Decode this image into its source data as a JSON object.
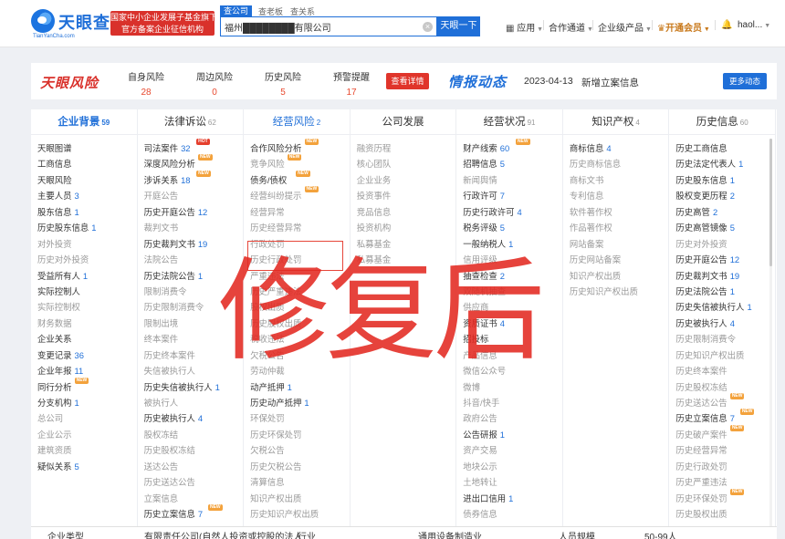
{
  "header": {
    "logo_title": "天眼查",
    "logo_sub": "TianYanCha.com",
    "gov_badge_line1": "国家中小企业发展子基金旗下",
    "gov_badge_line2": "官方备案企业征信机构",
    "search_tabs": [
      "查公司",
      "查老板",
      "查关系"
    ],
    "search_value": "福州████████有限公司",
    "search_button": "天眼一下",
    "nav": {
      "apps": "应用",
      "channel": "合作通道",
      "enterprise": "企业级产品",
      "vip": "开通会员",
      "user": "haol..."
    }
  },
  "risk": {
    "logo": "天眼风险",
    "stats": [
      {
        "label": "自身风险",
        "value": "28"
      },
      {
        "label": "周边风险",
        "value": "0"
      },
      {
        "label": "历史风险",
        "value": "5"
      },
      {
        "label": "预警提醒",
        "value": "17"
      }
    ],
    "detail_button": "查看详情",
    "intel_logo": "情报动态",
    "intel_date": "2023-04-13",
    "intel_text": "新增立案信息",
    "more_button": "更多动态"
  },
  "stamp_text": "修复后",
  "columns": [
    {
      "title": "企业背景",
      "count": "59",
      "items": [
        {
          "t": "天眼图谱"
        },
        {
          "t": "工商信息"
        },
        {
          "t": "天眼风险"
        },
        {
          "t": "主要人员",
          "n": "3"
        },
        {
          "t": "股东信息",
          "n": "1"
        },
        {
          "t": "历史股东信息",
          "n": "1"
        },
        {
          "t": "对外投资",
          "dim": true
        },
        {
          "t": "历史对外投资",
          "dim": true
        },
        {
          "t": "受益所有人",
          "n": "1"
        },
        {
          "t": "实际控制人"
        },
        {
          "t": "实际控制权",
          "dim": true
        },
        {
          "t": "财务数据",
          "dim": true
        },
        {
          "t": "企业关系"
        },
        {
          "t": "变更记录",
          "n": "36"
        },
        {
          "t": "企业年报",
          "n": "11"
        },
        {
          "t": "同行分析",
          "tag": "NEW"
        },
        {
          "t": "分支机构",
          "n": "1"
        },
        {
          "t": "总公司",
          "dim": true
        },
        {
          "t": "企业公示",
          "dim": true
        },
        {
          "t": "建筑资质",
          "dim": true
        },
        {
          "t": "疑似关系",
          "n": "5"
        }
      ]
    },
    {
      "title": "法律诉讼",
      "count": "62",
      "items": [
        {
          "t": "司法案件",
          "n": "32",
          "tag": "HOT",
          "hot": true
        },
        {
          "t": "深度风险分析",
          "tag": "NEW"
        },
        {
          "t": "涉诉关系",
          "n": "18",
          "tag": "NEW"
        },
        {
          "t": "开庭公告",
          "dim": true
        },
        {
          "t": "历史开庭公告",
          "n": "12"
        },
        {
          "t": "裁判文书",
          "dim": true
        },
        {
          "t": "历史裁判文书",
          "n": "19"
        },
        {
          "t": "法院公告",
          "dim": true
        },
        {
          "t": "历史法院公告",
          "n": "1"
        },
        {
          "t": "限制消费令",
          "dim": true
        },
        {
          "t": "历史限制消费令",
          "dim": true
        },
        {
          "t": "限制出境",
          "dim": true
        },
        {
          "t": "终本案件",
          "dim": true
        },
        {
          "t": "历史终本案件",
          "dim": true
        },
        {
          "t": "失信被执行人",
          "dim": true
        },
        {
          "t": "历史失信被执行人",
          "n": "1"
        },
        {
          "t": "被执行人",
          "dim": true
        },
        {
          "t": "历史被执行人",
          "n": "4"
        },
        {
          "t": "股权冻结",
          "dim": true
        },
        {
          "t": "历史股权冻结",
          "dim": true
        },
        {
          "t": "送达公告",
          "dim": true
        },
        {
          "t": "历史送达公告",
          "dim": true
        },
        {
          "t": "立案信息",
          "dim": true
        },
        {
          "t": "历史立案信息",
          "n": "7",
          "tag": "NEW"
        }
      ]
    },
    {
      "title": "经营风险",
      "count": "2",
      "items": [
        {
          "t": "合作风险分析",
          "tag": "NEW"
        },
        {
          "t": "竞争风险",
          "dim": true,
          "tag": "NEW"
        },
        {
          "t": "债务/债权",
          "tag": "NEW"
        },
        {
          "t": "经营纠纷提示",
          "dim": true,
          "tag": "NEW"
        },
        {
          "t": "经营异常",
          "dim": true
        },
        {
          "t": "历史经营异常",
          "dim": true
        },
        {
          "t": "行政处罚",
          "dim": true
        },
        {
          "t": "历史行政处罚",
          "dim": true
        },
        {
          "t": "严重违法",
          "dim": true
        },
        {
          "t": "历史严重违法",
          "dim": true
        },
        {
          "t": "股权出质",
          "dim": true
        },
        {
          "t": "历史股权出质",
          "dim": true
        },
        {
          "t": "税收违法",
          "dim": true
        },
        {
          "t": "欠税公告",
          "dim": true
        },
        {
          "t": "劳动仲裁",
          "dim": true
        },
        {
          "t": "动产抵押",
          "n": "1"
        },
        {
          "t": "历史动产抵押",
          "n": "1"
        },
        {
          "t": "环保处罚",
          "dim": true
        },
        {
          "t": "历史环保处罚",
          "dim": true
        },
        {
          "t": "欠税公告",
          "dim": true
        },
        {
          "t": "历史欠税公告",
          "dim": true
        },
        {
          "t": "清算信息",
          "dim": true
        },
        {
          "t": "知识产权出质",
          "dim": true
        },
        {
          "t": "历史知识产权出质",
          "dim": true
        }
      ]
    },
    {
      "title": "公司发展",
      "count": "",
      "items": [
        {
          "t": "融资历程",
          "dim": true
        },
        {
          "t": "核心团队",
          "dim": true
        },
        {
          "t": "企业业务",
          "dim": true
        },
        {
          "t": "投资事件",
          "dim": true
        },
        {
          "t": "竞品信息",
          "dim": true
        },
        {
          "t": "投资机构",
          "dim": true
        },
        {
          "t": "私募基金",
          "dim": true
        },
        {
          "t": "私募基金",
          "dim": true
        }
      ]
    },
    {
      "title": "经营状况",
      "count": "91",
      "items": [
        {
          "t": "财产线索",
          "n": "60",
          "tag": "NEW"
        },
        {
          "t": "招聘信息",
          "n": "5"
        },
        {
          "t": "新闻舆情",
          "dim": true
        },
        {
          "t": "行政许可",
          "n": "7"
        },
        {
          "t": "历史行政许可",
          "n": "4"
        },
        {
          "t": "税务评级",
          "n": "5"
        },
        {
          "t": "一般纳税人",
          "n": "1"
        },
        {
          "t": "信用评级",
          "dim": true
        },
        {
          "t": "抽查检查",
          "n": "2"
        },
        {
          "t": "双随机抽查",
          "dim": true
        },
        {
          "t": "供应商",
          "dim": true
        },
        {
          "t": "资质证书",
          "n": "4"
        },
        {
          "t": "招投标"
        },
        {
          "t": "产品信息",
          "dim": true
        },
        {
          "t": "微信公众号",
          "dim": true
        },
        {
          "t": "微博",
          "dim": true
        },
        {
          "t": "抖音/快手",
          "dim": true
        },
        {
          "t": "政府公告",
          "dim": true
        },
        {
          "t": "公告研报",
          "n": "1"
        },
        {
          "t": "资产交易",
          "dim": true
        },
        {
          "t": "地块公示",
          "dim": true
        },
        {
          "t": "土地转让",
          "dim": true
        },
        {
          "t": "进出口信用",
          "n": "1"
        },
        {
          "t": "债券信息",
          "dim": true
        }
      ]
    },
    {
      "title": "知识产权",
      "count": "4",
      "items": [
        {
          "t": "商标信息",
          "n": "4"
        },
        {
          "t": "历史商标信息",
          "dim": true
        },
        {
          "t": "商标文书",
          "dim": true
        },
        {
          "t": "专利信息",
          "dim": true
        },
        {
          "t": "软件著作权",
          "dim": true
        },
        {
          "t": "作品著作权",
          "dim": true
        },
        {
          "t": "网站备案",
          "dim": true
        },
        {
          "t": "历史网站备案",
          "dim": true
        },
        {
          "t": "知识产权出质",
          "dim": true
        },
        {
          "t": "历史知识产权出质",
          "dim": true
        }
      ]
    },
    {
      "title": "历史信息",
      "count": "60",
      "items": [
        {
          "t": "历史工商信息"
        },
        {
          "t": "历史法定代表人",
          "n": "1"
        },
        {
          "t": "历史股东信息",
          "n": "1"
        },
        {
          "t": "股权变更历程",
          "n": "2"
        },
        {
          "t": "历史高管",
          "n": "2"
        },
        {
          "t": "历史高管镜像",
          "n": "5"
        },
        {
          "t": "历史对外投资",
          "dim": true
        },
        {
          "t": "历史开庭公告",
          "n": "12"
        },
        {
          "t": "历史裁判文书",
          "n": "19"
        },
        {
          "t": "历史法院公告",
          "n": "1"
        },
        {
          "t": "历史失信被执行人",
          "n": "1"
        },
        {
          "t": "历史被执行人",
          "n": "4"
        },
        {
          "t": "历史限制消费令",
          "dim": true
        },
        {
          "t": "历史知识产权出质",
          "dim": true
        },
        {
          "t": "历史终本案件",
          "dim": true
        },
        {
          "t": "历史股权冻结",
          "dim": true
        },
        {
          "t": "历史送达公告",
          "dim": true,
          "tag": "NEW"
        },
        {
          "t": "历史立案信息",
          "n": "7",
          "tag": "NEW"
        },
        {
          "t": "历史破产案件",
          "dim": true,
          "tag": "NEW"
        },
        {
          "t": "历史经营异常",
          "dim": true
        },
        {
          "t": "历史行政处罚",
          "dim": true
        },
        {
          "t": "历史严重违法",
          "dim": true
        },
        {
          "t": "历史环保处罚",
          "dim": true,
          "tag": "NEW"
        },
        {
          "t": "历史股权出质",
          "dim": true
        }
      ]
    }
  ],
  "base_row": {
    "label1": "企业类型",
    "value1": "有限责任公司(自然人投资或控股的法人",
    "label2": "行业",
    "value2": "通用设备制造业",
    "label3": "人员规模",
    "value3": "50-99人"
  }
}
